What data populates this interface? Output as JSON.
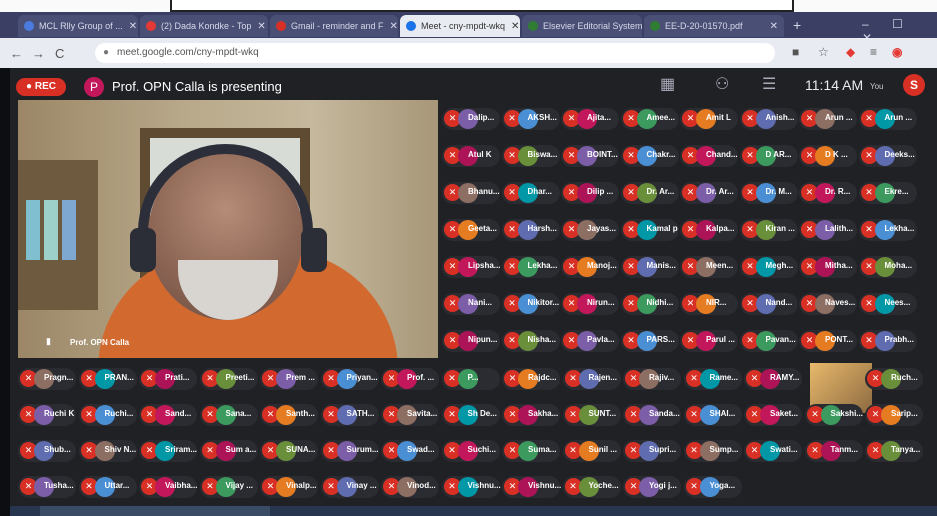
{
  "browser": {
    "tabs": [
      {
        "label": "MCL Rlly Group of ...",
        "favicon_color": "#4a7be0",
        "active": false
      },
      {
        "label": "(2) Dada Kondke - Top",
        "favicon_color": "#e53935",
        "active": false
      },
      {
        "label": "Gmail - reminder and F",
        "favicon_color": "#d93025",
        "active": false
      },
      {
        "label": "Meet - cny-mpdt-wkq",
        "favicon_color": "#1a73e8",
        "active": true
      },
      {
        "label": "Elsevier Editorial System",
        "favicon_color": "#2e7d32",
        "active": false
      },
      {
        "label": "EE-D-20-01570.pdf",
        "favicon_color": "#2e7d32",
        "active": false
      }
    ],
    "new_tab": "+",
    "window_controls": "‒ ☐ ✕",
    "back": "←",
    "forward": "→",
    "reload": "C",
    "url": "meet.google.com/cny-mpdt-wkq",
    "toolbar_icons": [
      "camera-icon",
      "star-icon",
      "extension-icon",
      "menu-icon"
    ]
  },
  "meet": {
    "rec_label": "● REC",
    "presenter_initial": "P",
    "presenter_text": "Prof. OPN Calla is presenting",
    "clock": "11:14 AM",
    "you_label": "You",
    "you_initial": "S",
    "main_video_name": "Prof. OPN Calla",
    "participants": [
      [
        "Dalip...",
        "AKSH...",
        "Ajita...",
        "Amee...",
        "Amit L",
        "Anish...",
        "Arun ...",
        "Arun ..."
      ],
      [
        "Atul K",
        "Biswa...",
        "BOINT...",
        "Chakr...",
        "Chand...",
        "D AR...",
        "D K ...",
        "Deeks..."
      ],
      [
        "Bhanu...",
        "Dhar...",
        "Dilip ...",
        "Dr. Ar...",
        "Dr. Ar...",
        "Dr. M...",
        "Dr. R...",
        "Ekre..."
      ],
      [
        "Geeta...",
        "Harsh...",
        "Jayas...",
        "Kamal p",
        "Kalpa...",
        "Kiran ...",
        "Lalith...",
        "Lekha..."
      ],
      [
        "Lipsha...",
        "Lekha...",
        "Manoj...",
        "Manis...",
        "Meen...",
        "Megh...",
        "Mitha...",
        "Moha..."
      ],
      [
        "Nani...",
        "Nikitor...",
        "Nirun...",
        "Nidhi...",
        "NIR...",
        "Nand...",
        "Naves...",
        "Nees..."
      ],
      [
        "Nipun...",
        "Nisha...",
        "Pavla...",
        "PARS...",
        "Parul ...",
        "Pavan...",
        "PONT...",
        "Prabh..."
      ]
    ],
    "participants_bottom": [
      [
        "Pragn...",
        "PRAN...",
        "Prati...",
        "Preeti...",
        "Prem ...",
        "Priyan...",
        "Prof. ...",
        "P...",
        "Rajdc...",
        "Rajen...",
        "Rajiv...",
        "Rame...",
        "RAMY...",
        "",
        "Ruch..."
      ],
      [
        "Ruchi K",
        "Ruchi...",
        "Sand...",
        "Sana...",
        "Santh...",
        "SATH...",
        "Savita...",
        "Sh De...",
        "Sakha...",
        "SUNT...",
        "Sanda...",
        "SHAI...",
        "Saket...",
        "Sakshi...",
        "Sarip..."
      ],
      [
        "Shub...",
        "Shiv N...",
        "Sriram...",
        "Sum a...",
        "SUNA...",
        "Surum...",
        "Swad...",
        "Suchi...",
        "Suma...",
        "Sunil ...",
        "Supri...",
        "Sump...",
        "Swati...",
        "Tanm...",
        "Tanya..."
      ],
      [
        "Tusha...",
        "Uttar...",
        "Vaibha...",
        "Vijay ...",
        "Vinalp...",
        "Vinay ...",
        "Vinod...",
        "Vishnu...",
        "Vishnu...",
        "Yoche...",
        "Yogi j...",
        "Yoga..."
      ]
    ],
    "avatar_colors": [
      "#7b5ea7",
      "#4a8fd4",
      "#c2185b",
      "#3c9a5f",
      "#e67c22",
      "#5f6caf",
      "#8d6e63",
      "#0097a7",
      "#ad1457",
      "#6a8f3a"
    ]
  }
}
